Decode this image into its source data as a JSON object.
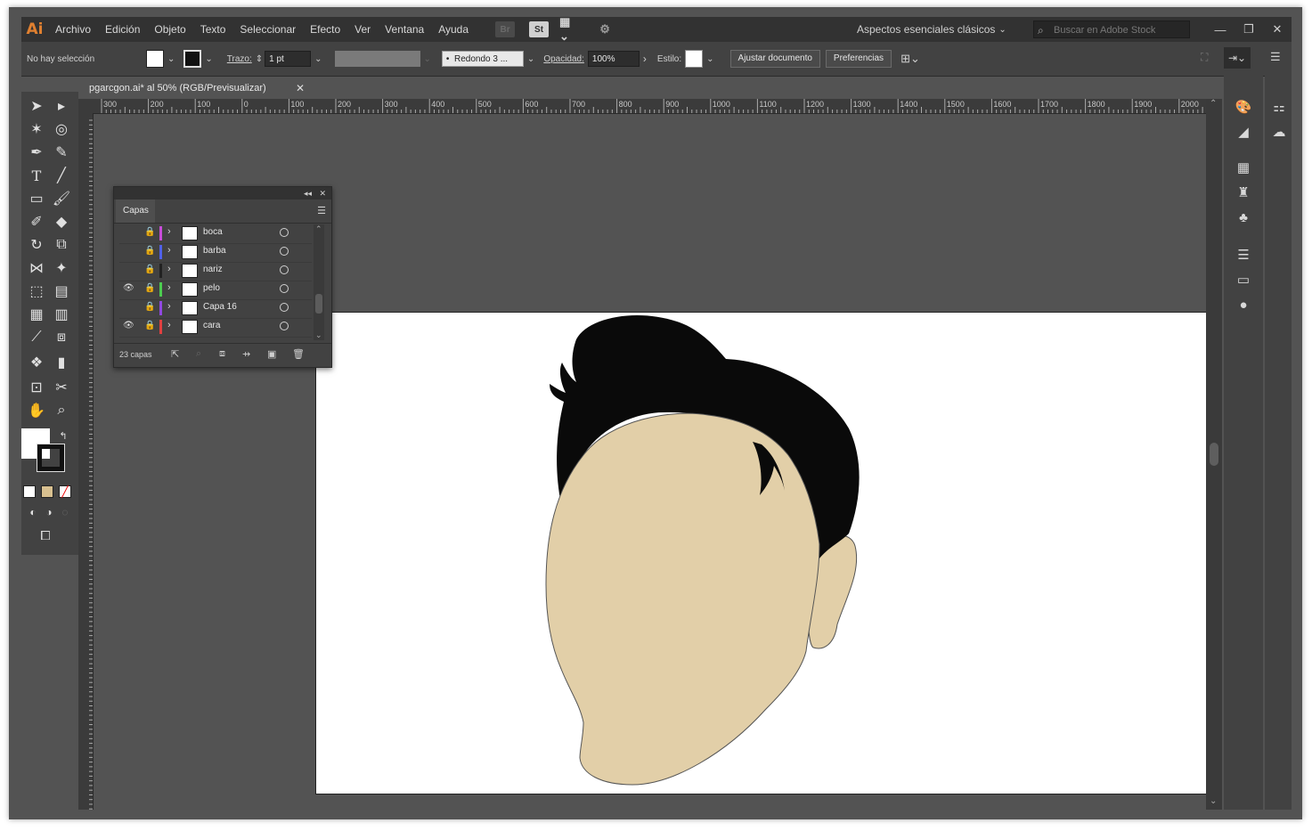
{
  "menubar": {
    "logo": "Ai",
    "items": [
      "Archivo",
      "Edición",
      "Objeto",
      "Texto",
      "Seleccionar",
      "Efecto",
      "Ver",
      "Ventana",
      "Ayuda"
    ],
    "br_icon": "Br",
    "st_icon": "St",
    "workspace": "Aspectos esenciales clásicos",
    "stock_placeholder": "Buscar en Adobe Stock"
  },
  "control": {
    "selection": "No hay selección",
    "stroke_label": "Trazo:",
    "stroke_value": "1 pt",
    "brush": "Redondo 3 ...",
    "opacity_label": "Opacidad:",
    "opacity_value": "100%",
    "style_label": "Estilo:",
    "fit_button": "Ajustar documento",
    "prefs_button": "Preferencias"
  },
  "document": {
    "tab_title": "pgarcgon.ai* al 50% (RGB/Previsualizar)"
  },
  "ruler": {
    "h_labels": [
      "300",
      "200",
      "100",
      "0",
      "100",
      "200",
      "300",
      "400",
      "500",
      "600",
      "700",
      "800",
      "900",
      "1000",
      "1100",
      "1200",
      "1300",
      "1400",
      "1500",
      "1600",
      "1700",
      "1800",
      "1900",
      "2000"
    ]
  },
  "layers": {
    "tab": "Capas",
    "count": "23 capas",
    "rows": [
      {
        "name": "boca",
        "color": "#c84cd8",
        "visible": false
      },
      {
        "name": "barba",
        "color": "#5060e8",
        "visible": false
      },
      {
        "name": "nariz",
        "color": "#222222",
        "visible": false
      },
      {
        "name": "pelo",
        "color": "#4ccc50",
        "visible": true
      },
      {
        "name": "Capa 16",
        "color": "#9048e0",
        "visible": false
      },
      {
        "name": "cara",
        "color": "#e04040",
        "visible": true
      }
    ]
  },
  "art": {
    "skin": "#e2cfa8",
    "hair": "#0a0a0a"
  }
}
